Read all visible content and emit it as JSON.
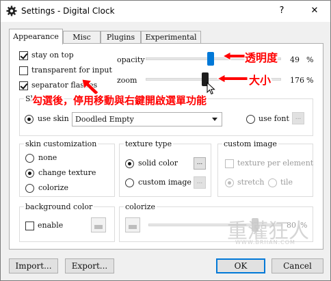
{
  "window": {
    "title": "Settings - Digital Clock",
    "help_label": "?",
    "close_label": "✕"
  },
  "tabs": [
    {
      "label": "Appearance",
      "active": true
    },
    {
      "label": "Misc",
      "active": false
    },
    {
      "label": "Plugins",
      "active": false
    },
    {
      "label": "Experimental",
      "active": false
    }
  ],
  "options": {
    "stay_on_top": {
      "label": "stay on top",
      "checked": true
    },
    "transparent_for_input": {
      "label": "transparent for input",
      "checked": false
    },
    "separator_flashes": {
      "label": "separator flashes",
      "checked": true
    }
  },
  "sliders": {
    "opacity": {
      "label": "opacity",
      "value": "49",
      "unit": "%",
      "position": 0.49
    },
    "zoom": {
      "label": "zoom",
      "value": "176",
      "unit": "%",
      "position": 0.43
    }
  },
  "skin_group": {
    "title_visible": "Sk",
    "use_skin_label": "use skin",
    "use_skin_selected": true,
    "skin_select_value": "Doodled Empty",
    "use_font_label": "use font",
    "font_button_label": "..."
  },
  "skin_customization": {
    "title": "skin customization",
    "options": [
      {
        "label": "none",
        "selected": false
      },
      {
        "label": "change texture",
        "selected": true
      },
      {
        "label": "colorize",
        "selected": false
      }
    ]
  },
  "texture_type": {
    "title": "texture type",
    "solid_color_label": "solid color",
    "custom_image_label": "custom image",
    "button_label": "..."
  },
  "custom_image": {
    "title": "custom image",
    "texture_per_element_label": "texture per element",
    "stretch_label": "stretch",
    "tile_label": "tile"
  },
  "background_color": {
    "title": "background color",
    "enable_label": "enable"
  },
  "colorize": {
    "title": "colorize",
    "value": "80",
    "unit": "%",
    "position": 0.8
  },
  "buttons": {
    "import": "Import...",
    "export": "Export...",
    "ok": "OK",
    "cancel": "Cancel"
  },
  "annotations": {
    "opacity_note": "透明度",
    "zoom_note": "大小",
    "menu_note": "勾選後，停用移動與右鍵開啟選單功能",
    "color": "#ff0000"
  },
  "watermark": {
    "logo_text": "重灌狂人",
    "url": "WWW.BRIIAN.COM"
  },
  "colors": {
    "accent": "#0078d7",
    "annotation": "#ff0000"
  }
}
